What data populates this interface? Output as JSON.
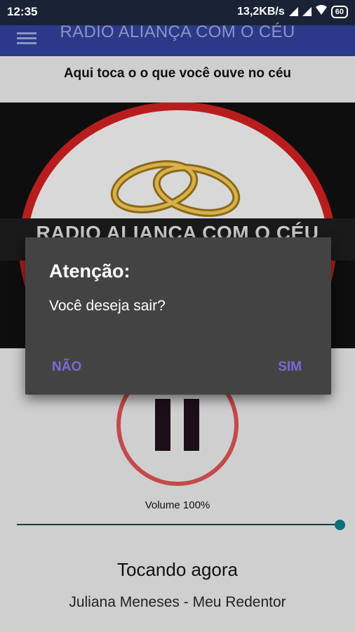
{
  "status_bar": {
    "time": "12:35",
    "network_speed": "13,2KB/s",
    "battery_level": "60"
  },
  "app_bar": {
    "title": "RADIO ALIANÇA COM O CÉU"
  },
  "subtitle": "Aqui toca o o que você ouve no céu",
  "banner": {
    "text": "RADIO ALIANÇA COM O CÉU"
  },
  "player": {
    "volume_label": "Volume 100%",
    "volume_level": 1.0,
    "now_playing_label": "Tocando agora",
    "track": "Juliana Meneses - Meu Redentor"
  },
  "dialog": {
    "title": "Atenção:",
    "message": "Você deseja sair?",
    "negative_button": "NÃO",
    "positive_button": "SIM"
  },
  "colors": {
    "app_bar": "#2b3988",
    "status_bar": "#1a2236",
    "dialog_bg": "#434343",
    "dialog_button": "#7b6ad9",
    "accent_thumb": "#0c6f7a",
    "play_ring": "#c44a4a"
  }
}
